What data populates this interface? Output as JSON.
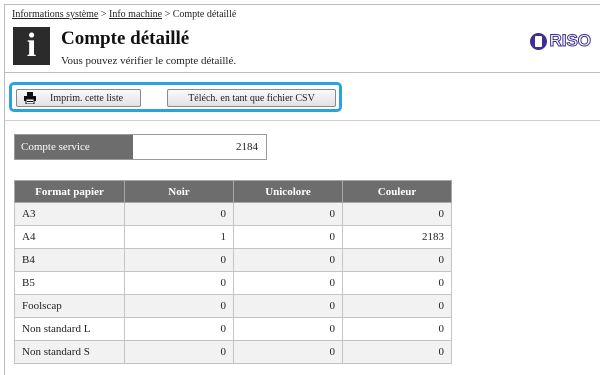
{
  "breadcrumb": {
    "item1": "Informations système",
    "sep1": " > ",
    "item2": "Info machine",
    "sep2": " > ",
    "current": "Compte détaillé"
  },
  "header": {
    "info_glyph": "i",
    "title": "Compte détaillé",
    "subtitle": "Vous pouvez vérifier le compte détaillé.",
    "brand": "RISO",
    "brand_color": "#3f2f8f"
  },
  "toolbar": {
    "print_label": "Imprim. cette liste",
    "csv_label": "Téléch. en tant que fichier CSV",
    "highlight_color": "#29a3dd"
  },
  "service": {
    "label": "Compte service",
    "value": "2184"
  },
  "table": {
    "headers": [
      "Format papier",
      "Noir",
      "Unicolore",
      "Couleur"
    ],
    "rows": [
      [
        "A3",
        "0",
        "0",
        "0"
      ],
      [
        "A4",
        "1",
        "0",
        "2183"
      ],
      [
        "B4",
        "0",
        "0",
        "0"
      ],
      [
        "B5",
        "0",
        "0",
        "0"
      ],
      [
        "Foolscap",
        "0",
        "0",
        "0"
      ],
      [
        "Non standard L",
        "0",
        "0",
        "0"
      ],
      [
        "Non standard S",
        "0",
        "0",
        "0"
      ]
    ]
  }
}
